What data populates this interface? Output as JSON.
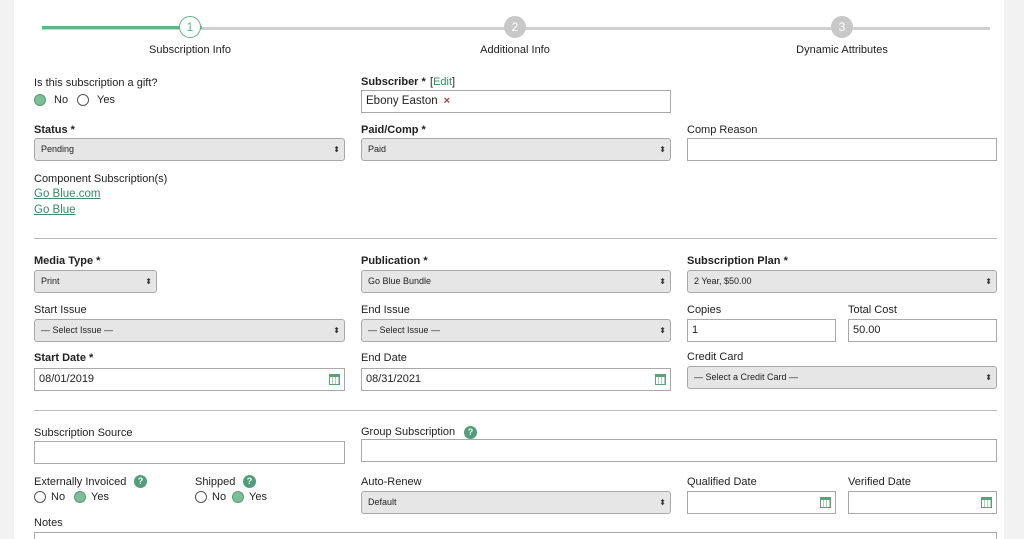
{
  "steps": [
    {
      "number": "1",
      "label": "Subscription Info"
    },
    {
      "number": "2",
      "label": "Additional Info"
    },
    {
      "number": "3",
      "label": "Dynamic Attributes"
    }
  ],
  "gift": {
    "label": "Is this subscription a gift?",
    "no": "No",
    "yes": "Yes"
  },
  "subscriber": {
    "label": "Subscriber *",
    "edit": "Edit",
    "value": "Ebony Easton",
    "remove": "×"
  },
  "status": {
    "label": "Status *",
    "value": "Pending"
  },
  "paid_comp": {
    "label": "Paid/Comp *",
    "value": "Paid"
  },
  "comp_reason": {
    "label": "Comp Reason",
    "value": ""
  },
  "components": {
    "label": "Component Subscription(s)",
    "links": [
      "Go Blue.com",
      "Go Blue"
    ]
  },
  "media_type": {
    "label": "Media Type *",
    "value": "Print"
  },
  "publication": {
    "label": "Publication *",
    "value": "Go Blue Bundle"
  },
  "plan": {
    "label": "Subscription Plan *",
    "value": "2 Year, $50.00"
  },
  "start_issue": {
    "label": "Start Issue",
    "value": "— Select Issue —"
  },
  "end_issue": {
    "label": "End Issue",
    "value": "— Select Issue —"
  },
  "copies": {
    "label": "Copies",
    "value": "1"
  },
  "total_cost": {
    "label": "Total Cost",
    "value": "50.00"
  },
  "start_date": {
    "label": "Start Date *",
    "value": "08/01/2019"
  },
  "end_date": {
    "label": "End Date",
    "value": "08/31/2021"
  },
  "credit_card": {
    "label": "Credit Card",
    "value": "— Select a Credit Card —"
  },
  "source": {
    "label": "Subscription Source",
    "value": ""
  },
  "group": {
    "label": "Group Subscription",
    "value": ""
  },
  "ext_invoiced": {
    "label": "Externally Invoiced",
    "no": "No",
    "yes": "Yes"
  },
  "shipped": {
    "label": "Shipped",
    "no": "No",
    "yes": "Yes"
  },
  "auto_renew": {
    "label": "Auto-Renew",
    "value": "Default"
  },
  "qualified_date": {
    "label": "Qualified Date",
    "value": ""
  },
  "verified_date": {
    "label": "Verified Date",
    "value": ""
  },
  "notes": {
    "label": "Notes"
  },
  "icons": {
    "help": "?",
    "select_arrow": "⬍"
  },
  "colors": {
    "accent": "#5cb887",
    "step_inactive": "#c8c8c8",
    "link": "#3a8a64"
  }
}
